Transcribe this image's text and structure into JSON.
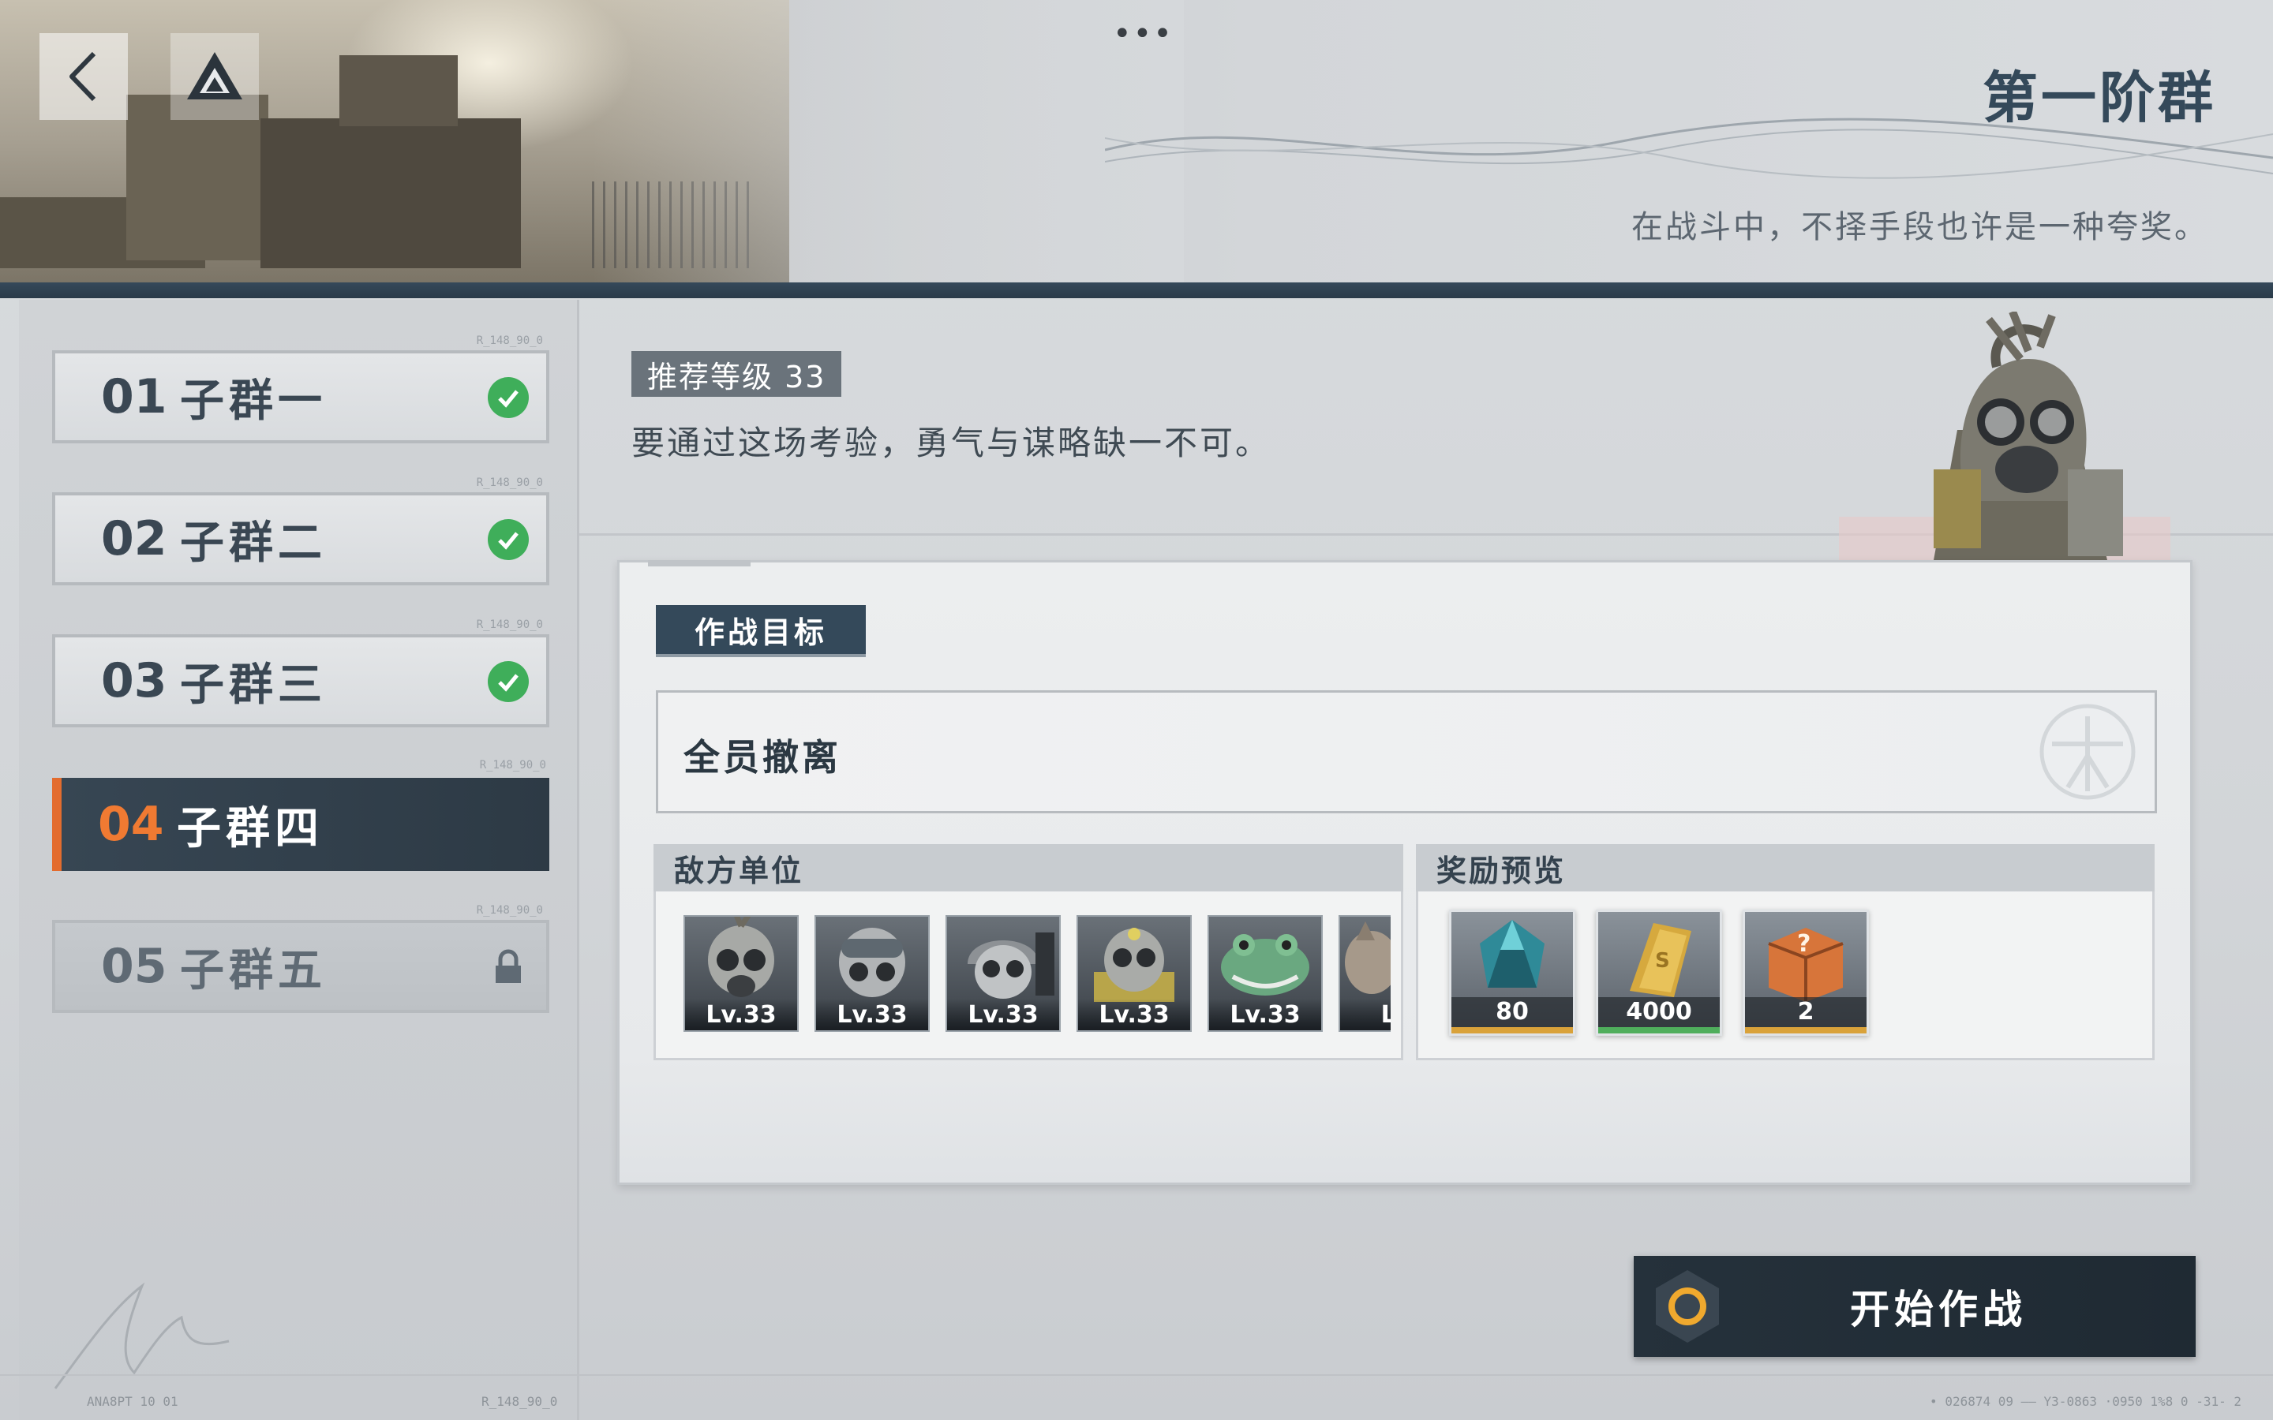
{
  "header": {
    "stage_title": "第一阶群",
    "stage_subtitle": "在战斗中，不择手段也许是一种夸奖。",
    "menu_dots": "•••"
  },
  "sidebar": {
    "items": [
      {
        "num": "01",
        "name": "子群一",
        "state": "cleared",
        "tag": "R_148_90_0"
      },
      {
        "num": "02",
        "name": "子群二",
        "state": "cleared",
        "tag": "R_148_90_0"
      },
      {
        "num": "03",
        "name": "子群三",
        "state": "cleared",
        "tag": "R_148_90_0"
      },
      {
        "num": "04",
        "name": "子群四",
        "state": "selected",
        "tag": "R_148_90_0"
      },
      {
        "num": "05",
        "name": "子群五",
        "state": "locked",
        "tag": "R_148_90_0"
      }
    ]
  },
  "stage": {
    "recommended_level": "推荐等级 33",
    "description": "要通过这场考验，勇气与谋略缺一不可。"
  },
  "objective": {
    "label": "作战目标",
    "text": "全员撤离"
  },
  "enemies": {
    "label": "敌方单位",
    "units": [
      {
        "level": "Lv.33",
        "icon": "gasmask-soldier-icon"
      },
      {
        "level": "Lv.33",
        "icon": "goggles-gasmask-icon"
      },
      {
        "level": "Lv.33",
        "icon": "helmet-gasmask-icon"
      },
      {
        "level": "Lv.33",
        "icon": "yellow-armor-gasmask-icon"
      },
      {
        "level": "Lv.33",
        "icon": "frog-creature-icon"
      },
      {
        "level": "Lv",
        "icon": "beast-enemy-icon"
      }
    ]
  },
  "rewards": {
    "label": "奖励预览",
    "items": [
      {
        "count": "80",
        "icon": "crystal-gem-icon",
        "bar_color": "#d9a23a"
      },
      {
        "count": "4000",
        "icon": "gold-bars-icon",
        "bar_color": "#4fae5c"
      },
      {
        "count": "2",
        "icon": "supply-crate-icon",
        "bar_color": "#d9a23a"
      }
    ]
  },
  "actions": {
    "start_label": "开始作战"
  },
  "footer": {
    "left_code": "ANA8PT 10        01",
    "left_tag": "R_148_90_0",
    "right_code": "• 026874 09    ——    Y3-0863 ·0950  1%8 0       -31-    2"
  },
  "colors": {
    "accent_orange": "#e36c2e",
    "navy": "#34495a",
    "cleared_green": "#3fae5a"
  }
}
